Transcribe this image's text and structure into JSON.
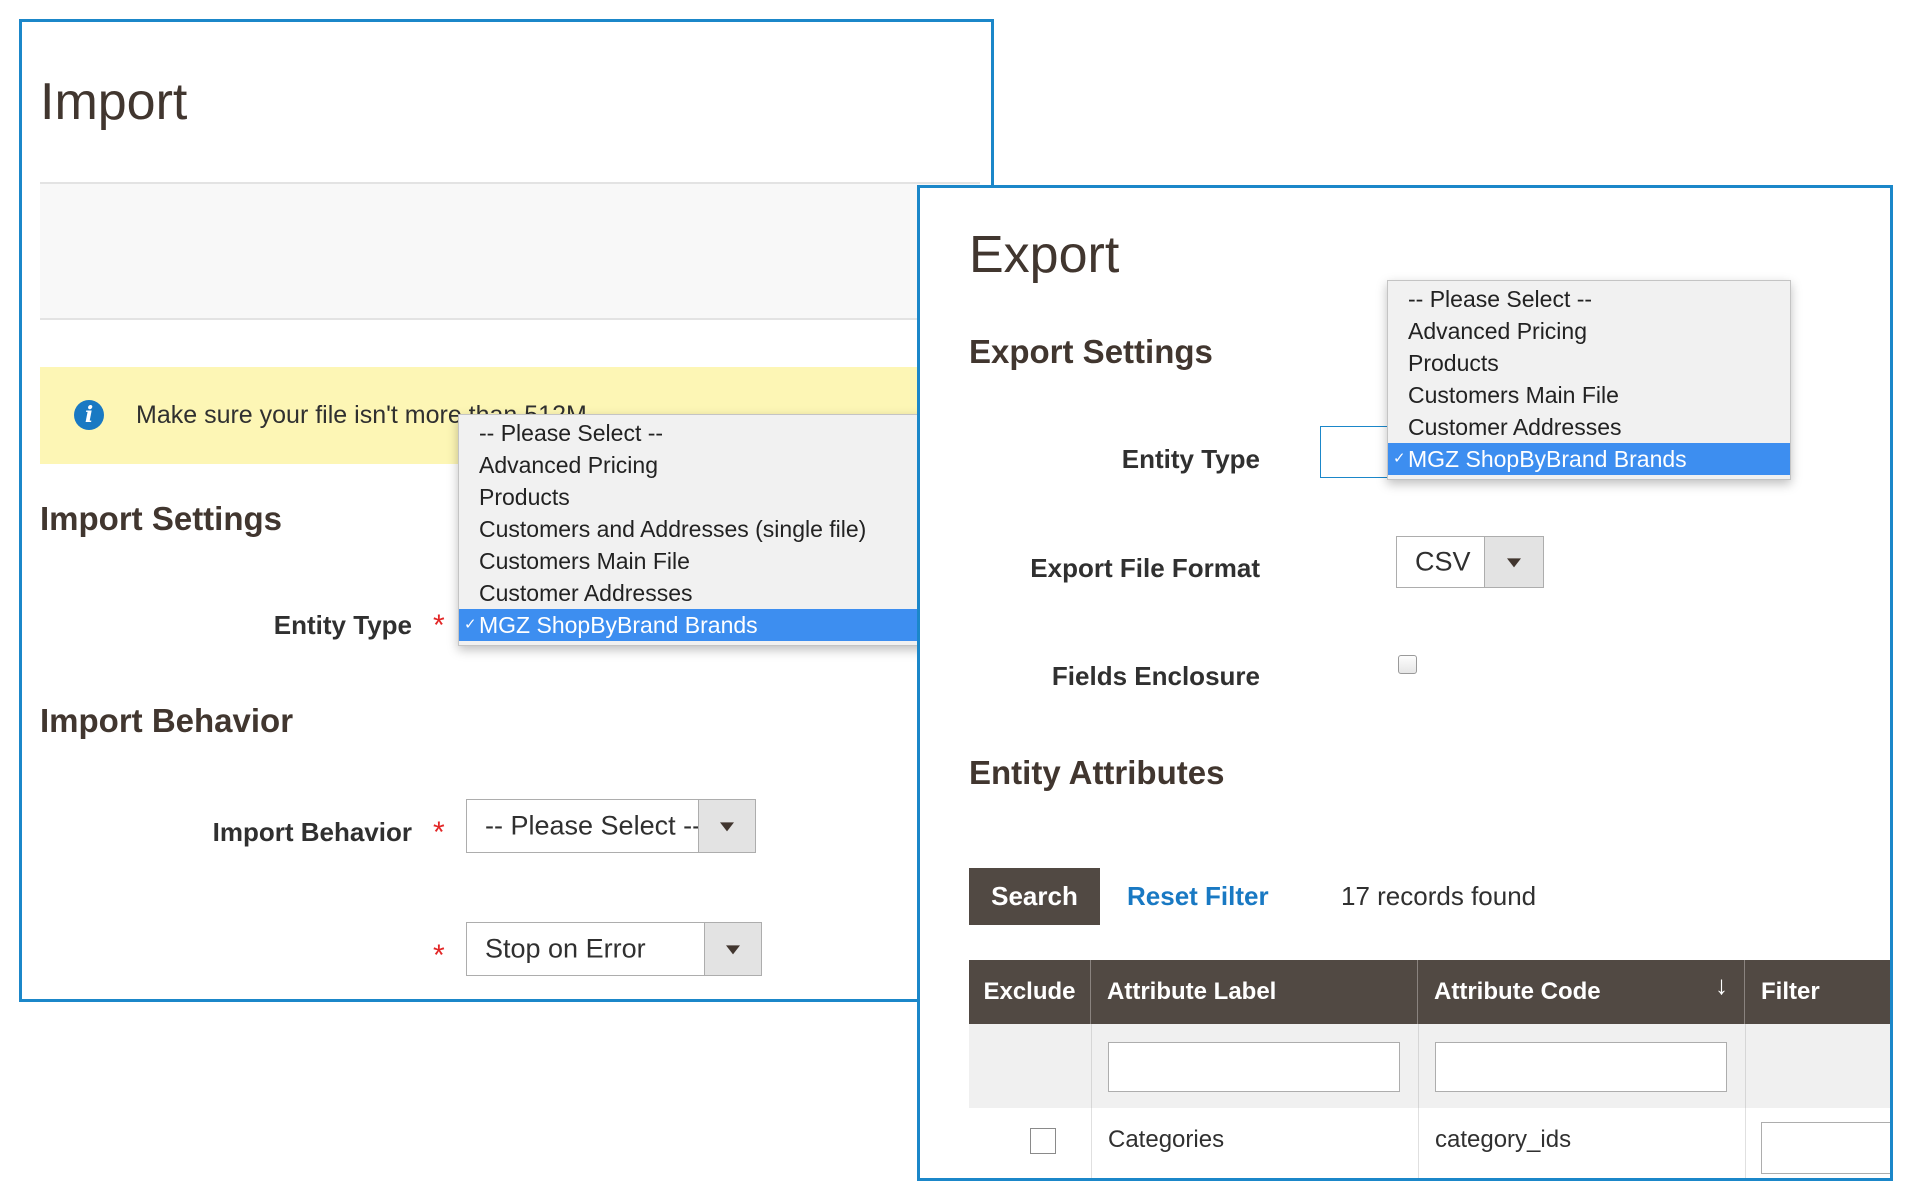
{
  "import_panel": {
    "title": "Import",
    "message": "Make sure your file isn't more than 512M.",
    "settings_heading": "Import Settings",
    "entity_type_label": "Entity Type",
    "required_mark": "*",
    "entity_type_options": [
      "-- Please Select --",
      "Advanced Pricing",
      "Products",
      "Customers and Addresses (single file)",
      "Customers Main File",
      "Customer Addresses",
      "MGZ ShopByBrand Brands"
    ],
    "entity_type_selected_index": 6,
    "behavior_heading": "Import Behavior",
    "behavior_label": "Import Behavior",
    "behavior_value": "-- Please Select --",
    "validation_value": "Stop on Error"
  },
  "export_panel": {
    "title": "Export",
    "settings_heading": "Export Settings",
    "entity_type_label": "Entity Type",
    "entity_type_options": [
      "-- Please Select --",
      "Advanced Pricing",
      "Products",
      "Customers Main File",
      "Customer Addresses",
      "MGZ ShopByBrand Brands"
    ],
    "entity_type_selected_index": 5,
    "file_format_label": "Export File Format",
    "file_format_value": "CSV",
    "fields_enclosure_label": "Fields Enclosure",
    "attributes_heading": "Entity Attributes",
    "search_button": "Search",
    "reset_filter_link": "Reset Filter",
    "records_found": "17 records found",
    "grid": {
      "columns": [
        "Exclude",
        "Attribute Label",
        "Attribute Code",
        "Filter"
      ],
      "sort_indicator": "↓",
      "rows": [
        {
          "label": "Categories",
          "code": "category_ids"
        }
      ]
    }
  },
  "colors": {
    "panel_border": "#1b87c9",
    "message_bg": "#fdf6b5",
    "info_icon": "#1979c3",
    "required": "#e22626",
    "selected_option": "#3d8ef0",
    "grid_header": "#514943",
    "search_button": "#514943",
    "link": "#1979c3"
  }
}
